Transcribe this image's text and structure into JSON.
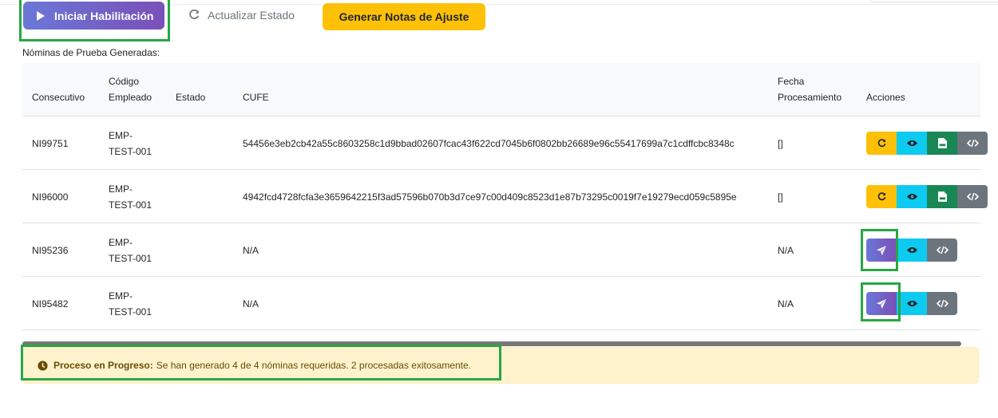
{
  "toolbar": {
    "start_label": "Iniciar Habilitación",
    "refresh_label": "Actualizar Estado",
    "notes_label": "Generar Notas de Ajuste"
  },
  "section_title": "Nóminas de Prueba Generadas:",
  "table": {
    "headers": {
      "consecutivo": "Consecutivo",
      "codigo_l1": "Código",
      "codigo_l2": "Empleado",
      "estado": "Estado",
      "cufe": "CUFE",
      "fecha_l1": "Fecha",
      "fecha_l2": "Procesamiento",
      "acciones": "Acciones"
    },
    "rows": [
      {
        "consecutivo": "NI99751",
        "emp_l1": "EMP-",
        "emp_l2": "TEST-001",
        "estado": "",
        "cufe": "54456e3eb2cb42a55c8603258c1d9bbad02607fcac43f622cd7045b6f0802bb26689e96c55417699a7c1cdffcbc8348c",
        "fecha": "[]"
      },
      {
        "consecutivo": "NI96000",
        "emp_l1": "EMP-",
        "emp_l2": "TEST-001",
        "estado": "",
        "cufe": "4942fcd4728fcfa3e3659642215f3ad57596b070b3d7ce97c00d409c8523d1e87b73295c0019f7e19279ecd059c5895e",
        "fecha": "[]"
      },
      {
        "consecutivo": "NI95236",
        "emp_l1": "EMP-",
        "emp_l2": "TEST-001",
        "estado": "",
        "cufe": "N/A",
        "fecha": "N/A"
      },
      {
        "consecutivo": "NI95482",
        "emp_l1": "EMP-",
        "emp_l2": "TEST-001",
        "estado": "",
        "cufe": "N/A",
        "fecha": "N/A"
      }
    ]
  },
  "alert": {
    "strong": "Proceso en Progreso:",
    "text": "Se han generado 4 de 4 nóminas requeridas. 2 procesadas exitosamente."
  },
  "colors": {
    "highlight": "#28a745",
    "primary_gradient_start": "#6a78d8",
    "primary_gradient_end": "#7a4fb8",
    "warning": "#ffc107",
    "info": "#0dcaf0",
    "success": "#198754",
    "secondary": "#6c757d"
  },
  "icons": {
    "start": "play-icon",
    "refresh": "refresh-icon",
    "retry": "redo-icon",
    "view": "eye-icon",
    "pdf": "pdf-file-icon",
    "xml": "code-icon",
    "send": "paper-plane-icon",
    "alert": "clock-icon"
  }
}
